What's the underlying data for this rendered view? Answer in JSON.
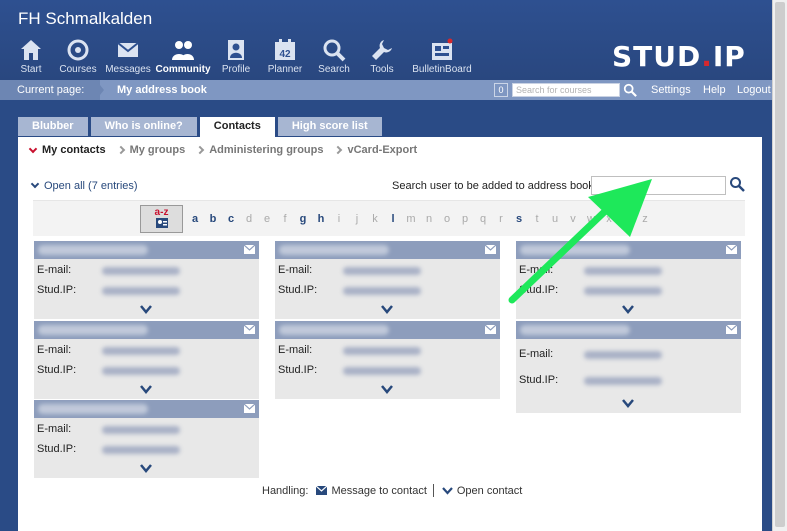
{
  "site_title": "FH Schmalkalden",
  "nav": [
    {
      "label": "Start",
      "icon": "home-icon",
      "active": false
    },
    {
      "label": "Courses",
      "icon": "courses-icon",
      "active": false
    },
    {
      "label": "Messages",
      "icon": "mail-icon",
      "active": false
    },
    {
      "label": "Community",
      "icon": "people-icon",
      "active": true
    },
    {
      "label": "Profile",
      "icon": "profile-icon",
      "active": false
    },
    {
      "label": "Planner",
      "icon": "calendar-icon",
      "active": false
    },
    {
      "label": "Search",
      "icon": "search-icon",
      "active": false
    },
    {
      "label": "Tools",
      "icon": "wrench-icon",
      "active": false
    },
    {
      "label": "BulletinBoard",
      "icon": "bulletin-board-icon",
      "active": false
    }
  ],
  "logo": {
    "prefix": "STUD",
    "dot": ".",
    "suffix": "IP"
  },
  "subbar": {
    "current_label": "Current page:",
    "page": "My address book",
    "counter": "0",
    "course_search_placeholder": "Search for courses",
    "links": [
      "Settings",
      "Help",
      "Logout"
    ]
  },
  "tabs": [
    {
      "label": "Blubber",
      "active": false
    },
    {
      "label": "Who is online?",
      "active": false
    },
    {
      "label": "Contacts",
      "active": true
    },
    {
      "label": "High score list",
      "active": false
    }
  ],
  "subnav": [
    {
      "label": "My contacts",
      "active": true
    },
    {
      "label": "My groups",
      "active": false
    },
    {
      "label": "Administering groups",
      "active": false
    },
    {
      "label": "vCard-Export",
      "active": false
    }
  ],
  "open_all": "Open all (7 entries)",
  "search_label": "Search user to be added to address book:",
  "search_value": "",
  "az_label": "a-z",
  "letters": [
    "a",
    "b",
    "c",
    "d",
    "e",
    "f",
    "g",
    "h",
    "i",
    "j",
    "k",
    "l",
    "m",
    "n",
    "o",
    "p",
    "q",
    "r",
    "s",
    "t",
    "u",
    "v",
    "w",
    "x",
    "y",
    "z"
  ],
  "active_letters": [
    "a",
    "b",
    "c",
    "g",
    "h",
    "l",
    "s"
  ],
  "field_labels": {
    "email": "E-mail:",
    "studip": "Stud.IP:"
  },
  "footer": {
    "handling": "Handling:",
    "message": "Message to contact",
    "open": "Open contact"
  },
  "accent": "#28497c",
  "header_color": "#2e5090"
}
